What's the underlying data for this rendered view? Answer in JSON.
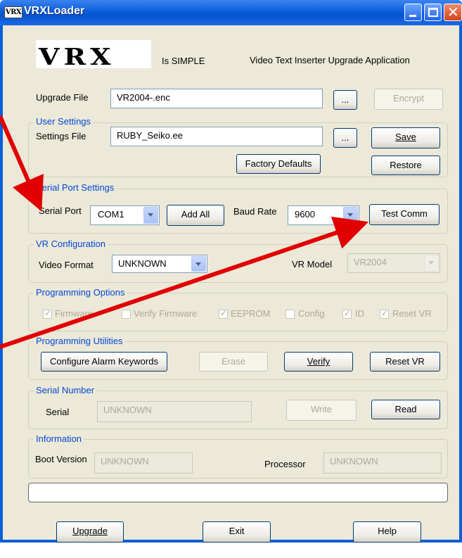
{
  "window": {
    "title": "VRXLoader",
    "app_icon_text": "VRX"
  },
  "header": {
    "logo_text": "VRX",
    "tagline": "Is SIMPLE",
    "description": "Video Text Inserter Upgrade Application"
  },
  "upgrade": {
    "label": "Upgrade File",
    "value": "VR2004-.enc",
    "browse_label": "...",
    "encrypt_label": "Encrypt"
  },
  "user_settings": {
    "group_label": "User Settings",
    "label": "Settings File",
    "value": "RUBY_Seiko.ee",
    "browse_label": "...",
    "save_label": "Save",
    "factory_label": "Factory Defaults",
    "restore_label": "Restore"
  },
  "serial_port": {
    "group_label": "Serial Port Settings",
    "port_label": "Serial Port",
    "port_value": "COM1",
    "add_all_label": "Add All",
    "baud_label": "Baud Rate",
    "baud_value": "9600",
    "test_label": "Test Comm"
  },
  "vr_config": {
    "group_label": "VR Configuration",
    "format_label": "Video Format",
    "format_value": "UNKNOWN",
    "model_label": "VR Model",
    "model_value": "VR2004"
  },
  "programming_options": {
    "group_label": "Programming Options",
    "options": [
      {
        "label": "Firmware",
        "checked": true
      },
      {
        "label": "Verify Firmware",
        "checked": false
      },
      {
        "label": "EEPROM",
        "checked": true
      },
      {
        "label": "Config",
        "checked": false
      },
      {
        "label": "ID",
        "checked": true
      },
      {
        "label": "Reset VR",
        "checked": true
      }
    ]
  },
  "programming_utilities": {
    "group_label": "Programming Utilities",
    "configure_label": "Configure Alarm Keywords",
    "erase_label": "Erase",
    "verify_label": "Verify",
    "reset_label": "Reset VR"
  },
  "serial_number": {
    "group_label": "Serial Number",
    "label": "Serial",
    "value": "UNKNOWN",
    "write_label": "Write",
    "read_label": "Read"
  },
  "information": {
    "group_label": "Information",
    "boot_label": "Boot Version",
    "boot_value": "UNKNOWN",
    "processor_label": "Processor",
    "processor_value": "UNKNOWN"
  },
  "progress": {
    "value": 0
  },
  "footer": {
    "upgrade_label": "Upgrade",
    "exit_label": "Exit",
    "help_label": "Help"
  },
  "colors": {
    "titlebar": "#0a5fd8",
    "annotation_arrow": "#e00000",
    "group_label": "#0046d5"
  }
}
